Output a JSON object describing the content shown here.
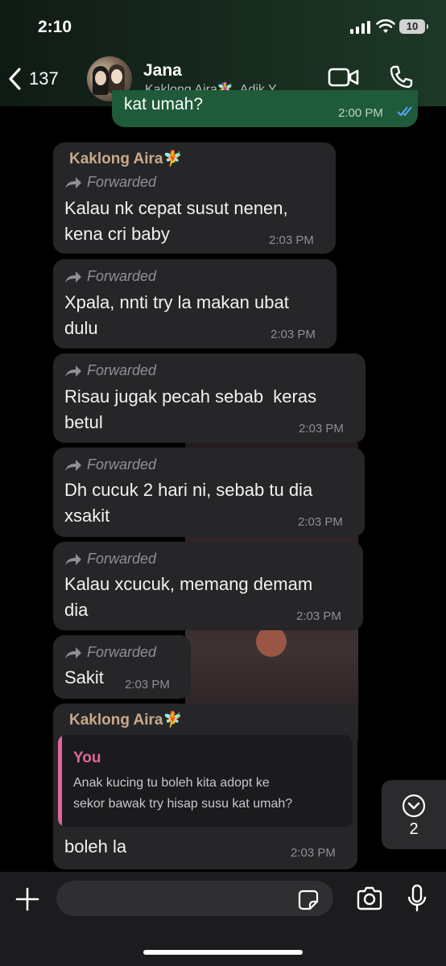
{
  "status_bar": {
    "time": "2:10",
    "battery": "10"
  },
  "header": {
    "back_count": "137",
    "name": "Jana",
    "subtitle": "Kaklong Aira🧚‍♀️, Adik Y..."
  },
  "sent": {
    "text": "kat umah?",
    "time": "2:00 PM"
  },
  "messages": [
    {
      "sender": "Kaklong Aira",
      "forwarded": "Forwarded",
      "lines": [
        "Kalau nk cepat susut nenen,",
        "kena cri baby"
      ],
      "time": "2:03 PM"
    },
    {
      "forwarded": "Forwarded",
      "lines": [
        "Xpala, nnti try la makan ubat",
        "dulu"
      ],
      "time": "2:03 PM"
    },
    {
      "forwarded": "Forwarded",
      "lines": [
        "Risau jugak pecah sebab  keras",
        "betul"
      ],
      "time": "2:03 PM"
    },
    {
      "forwarded": "Forwarded",
      "lines": [
        "Dh cucuk 2 hari ni, sebab tu dia",
        "xsakit"
      ],
      "time": "2:03 PM"
    },
    {
      "forwarded": "Forwarded",
      "lines": [
        "Kalau xcucuk, memang demam",
        "dia"
      ],
      "time": "2:03 PM"
    },
    {
      "forwarded": "Forwarded",
      "lines": [
        "Sakit"
      ],
      "time": "2:03 PM"
    },
    {
      "sender": "Kaklong Aira",
      "reply_author": "You",
      "reply_lines": [
        "Anak kucing tu boleh kita adopt ke",
        "sekor bawak try hisap susu kat umah?"
      ],
      "lines": [
        "boleh la"
      ],
      "time": "2:03 PM"
    }
  ],
  "fairy": "🧚",
  "scroll_chip": {
    "count": "2"
  },
  "composer": {
    "placeholder": ""
  }
}
